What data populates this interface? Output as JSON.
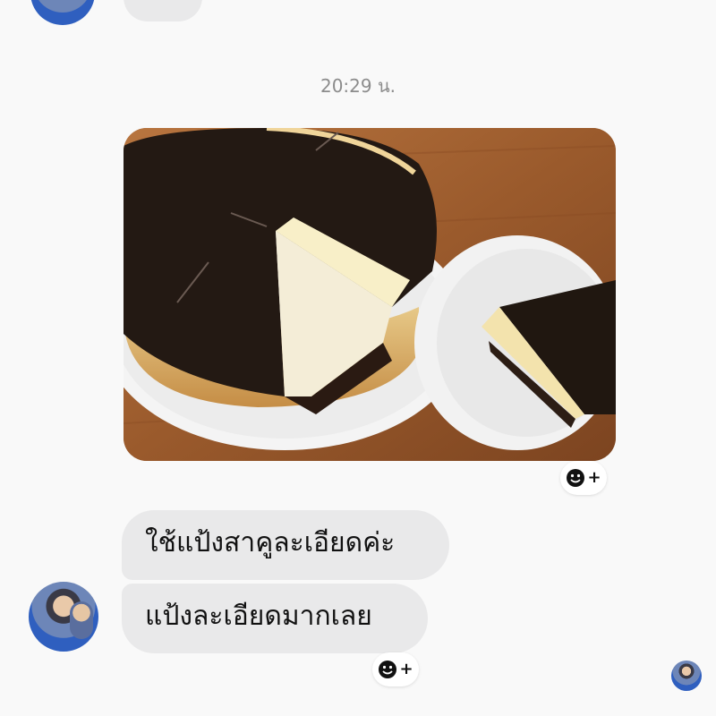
{
  "conversation": {
    "timestamp": "20:29 น.",
    "messages": [
      {
        "type": "image",
        "description_icon": "cake-photo"
      },
      {
        "type": "text",
        "text": "ใช้แป้งสาคูละเอียดค่ะ"
      },
      {
        "type": "text",
        "text": "แป้งละเอียดมากเลย"
      }
    ]
  },
  "reaction_button": {
    "icon": "smile-plus-icon",
    "plus": "+"
  },
  "colors": {
    "background": "#f9f9f9",
    "incoming_bubble": "#e9e9ea",
    "timestamp_text": "#8c8c8c"
  }
}
